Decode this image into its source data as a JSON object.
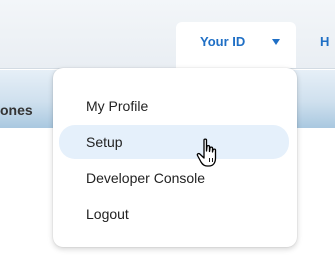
{
  "header": {
    "user_menu_label": "Your ID",
    "help_link_partial": "H"
  },
  "nav": {
    "tab_partial_label": "ones"
  },
  "user_menu": {
    "items": [
      {
        "label": "My Profile"
      },
      {
        "label": "Setup"
      },
      {
        "label": "Developer Console"
      },
      {
        "label": "Logout"
      }
    ],
    "hovered_item": "Setup"
  },
  "icons": {
    "caret": "caret-down-icon",
    "cursor": "hand-pointer-cursor-icon"
  },
  "colors": {
    "link_blue": "#1f6fc5",
    "hover_highlight": "#e5f0fb"
  }
}
